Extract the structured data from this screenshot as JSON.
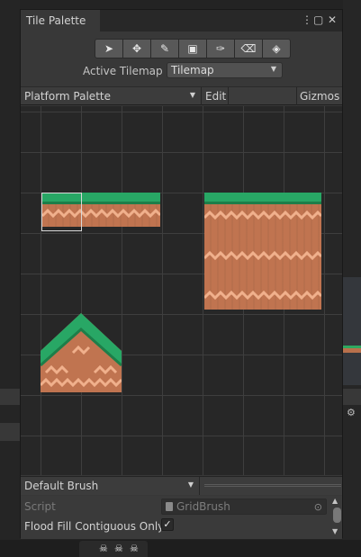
{
  "window": {
    "title": "Tile Palette",
    "menu_icon": "more-vert-icon",
    "maximize_icon": "maximize-icon",
    "close_icon": "close-icon"
  },
  "toolbar": {
    "tools": [
      {
        "name": "select-tool-button",
        "icon": "arrow-cursor-icon",
        "glyph": "➤"
      },
      {
        "name": "move-tool-button",
        "icon": "move-icon",
        "glyph": "✥"
      },
      {
        "name": "paint-tool-button",
        "icon": "brush-icon",
        "glyph": "✎"
      },
      {
        "name": "box-fill-tool-button",
        "icon": "box-fill-icon",
        "glyph": "▣"
      },
      {
        "name": "picker-tool-button",
        "icon": "eyedropper-icon",
        "glyph": "✑"
      },
      {
        "name": "eraser-tool-button",
        "icon": "eraser-icon",
        "glyph": "⌫"
      },
      {
        "name": "fill-tool-button",
        "icon": "bucket-fill-icon",
        "glyph": "◈"
      }
    ]
  },
  "active_tilemap": {
    "label": "Active Tilemap",
    "value": "Tilemap"
  },
  "palette_bar": {
    "palette": "Platform Palette",
    "edit": "Edit",
    "gizmos": "Gizmos"
  },
  "brush": {
    "selected": "Default Brush"
  },
  "inspector": {
    "script_label": "Script",
    "script_value": "GridBrush",
    "flood_fill_label": "Flood Fill Contiguous Only",
    "flood_fill_checked": "✓"
  },
  "colors": {
    "grass": "#28a765",
    "dirt": "#c07450",
    "wave": "#f0b08c"
  }
}
